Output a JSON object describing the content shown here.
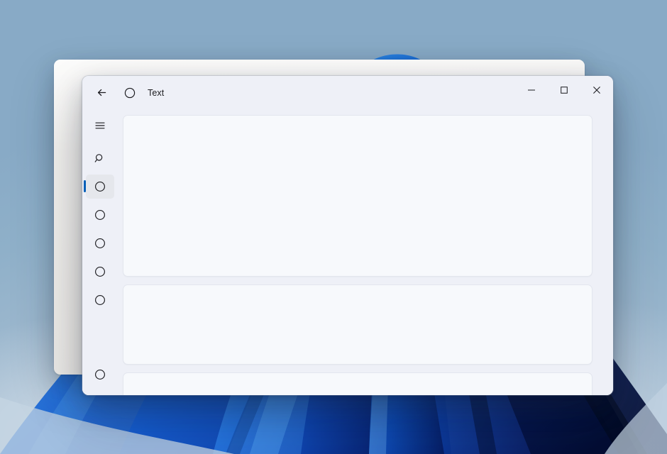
{
  "desktop": {
    "wallpaper_name": "windows-bloom-wallpaper",
    "wallpaper_colors": {
      "sky": "#8eaec8",
      "haze": "#ccdae6",
      "bloom_bright": "#2a7fe0",
      "bloom_mid": "#1357c8",
      "bloom_deep": "#0b2f86",
      "bloom_dark": "#071a४0"
    }
  },
  "background_window": {
    "name": "inactive-background-window",
    "surface_color": "#efedea"
  },
  "window": {
    "title": "Text",
    "app_icon": "circle-icon",
    "back_label": "Back",
    "surface_color": "#eef0f7",
    "accent_color": "#005fb8",
    "controls": {
      "minimize": "Minimize",
      "maximize": "Maximize",
      "close": "Close"
    }
  },
  "sidebar": {
    "menu_label": "Navigation menu",
    "search_label": "Search",
    "items": [
      {
        "id": "nav-1",
        "icon": "circle-icon",
        "label": "",
        "selected": true
      },
      {
        "id": "nav-2",
        "icon": "circle-icon",
        "label": "",
        "selected": false
      },
      {
        "id": "nav-3",
        "icon": "circle-icon",
        "label": "",
        "selected": false
      },
      {
        "id": "nav-4",
        "icon": "circle-icon",
        "label": "",
        "selected": false
      },
      {
        "id": "nav-5",
        "icon": "circle-icon",
        "label": "",
        "selected": false
      }
    ],
    "bottom_item": {
      "id": "nav-bottom",
      "icon": "circle-icon",
      "label": ""
    }
  },
  "content": {
    "cards": [
      {
        "id": "card-1",
        "text": ""
      },
      {
        "id": "card-2",
        "text": ""
      },
      {
        "id": "card-3",
        "text": ""
      }
    ]
  }
}
